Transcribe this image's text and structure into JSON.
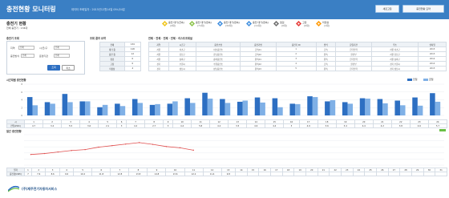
{
  "header": {
    "title": "충전현황 모니터링",
    "datetime": "데이터 조회일자 : 2015년12월14일 09시54분",
    "btn_refresh": "새로고침",
    "btn_settings": "충전현황 요약"
  },
  "info": {
    "title": "충전기 현황",
    "subtitle": "전체 충전기 : 134대"
  },
  "status_legend": [
    {
      "label": "충전 대기(급속)",
      "count": "(4대)",
      "color": "#f0c419"
    },
    {
      "label": "충전 대기(완속)",
      "count": "(71대)",
      "color": "#8bc34a"
    },
    {
      "label": "충전 대기(완속)",
      "count": "(32대)",
      "color": "#3f8ede"
    },
    {
      "label": "충전 대기(완속)",
      "count": "(11대)",
      "color": "#3f8ede"
    },
    {
      "label": "점검",
      "count": "(0대)",
      "color": "#6d6d6d"
    },
    {
      "label": "고장",
      "count": "(0대)",
      "color": "#e53935"
    },
    {
      "label": "미정상",
      "count": "(1대)",
      "color": "#ff9800"
    }
  ],
  "search": {
    "section_title": "충전기 조회",
    "fields": [
      {
        "label": "지역",
        "value": "전체"
      },
      {
        "label": "시/군/구",
        "value": "전체"
      },
      {
        "label": "충전방식",
        "value": "전체"
      },
      {
        "label": "운영기관",
        "value": "전체"
      }
    ],
    "search_btn": "조회",
    "reset_btn": "취소"
  },
  "summary": {
    "section_title": "조회 결과 요약",
    "rows": [
      {
        "k": "전체",
        "v": "134"
      },
      {
        "k": "대기 중",
        "v": "118"
      },
      {
        "k": "충전 중",
        "v": "12"
      },
      {
        "k": "점검",
        "v": "0"
      },
      {
        "k": "고장",
        "v": "0"
      },
      {
        "k": "미정상",
        "v": "4"
      }
    ]
  },
  "list": {
    "section_title": "전체 · 전체 · 전체 · 전체 · 리스트조회설",
    "headers": [
      "지역",
      "시군구",
      "충전소명",
      "충전기명",
      "충전기 ID",
      "방식",
      "운영기관",
      "주소",
      "설치일"
    ],
    "rows": [
      [
        "서울",
        "서초구",
        "서초충전소",
        "급속01",
        "1",
        "급속",
        "한국전력",
        "서울 서초구",
        "2015"
      ],
      [
        "서울",
        "강남구",
        "강남충전소",
        "급속02",
        "2",
        "완속",
        "환경부",
        "서울 강남구",
        "2015"
      ],
      [
        "서울",
        "송파구",
        "송파충전소",
        "완속01",
        "3",
        "완속",
        "한국전력",
        "서울 송파구",
        "2014"
      ],
      [
        "경기",
        "수원시",
        "수원충전소",
        "완속02",
        "4",
        "급속",
        "환경부",
        "경기 수원시",
        "2014"
      ],
      [
        "경기",
        "성남시",
        "성남충전소",
        "완속03",
        "5",
        "완속",
        "한국전력",
        "경기 성남시",
        "2015"
      ]
    ]
  },
  "hourly": {
    "section_title": "시간대별 충전현황",
    "legend": [
      "전일",
      "금일"
    ],
    "row_hours_label": "시",
    "row_prev_label": "전일(kWh)",
    "row_today_label": "금일(kWh)"
  },
  "daily": {
    "section_title": "일간 충전현황",
    "row_day_label": "일자",
    "row_value_label": "충전량(kWh)"
  },
  "footer": {
    "company": "(주)제주전기자동차서비스"
  },
  "chart_data": [
    {
      "type": "bar",
      "title": "",
      "categories": [
        "1",
        "2",
        "3",
        "4",
        "5",
        "6",
        "7",
        "8",
        "9",
        "10",
        "11",
        "12",
        "13",
        "14",
        "15",
        "16",
        "17",
        "18",
        "19",
        "20",
        "21",
        "22",
        "23",
        "24"
      ],
      "series": [
        {
          "name": "전일",
          "values": [
            4.7,
            3.4,
            5.5,
            3.6,
            2.1,
            3.0,
            4.2,
            2.7,
            3.0,
            4.4,
            5.8,
            4.2,
            3.5,
            4.6,
            4.4,
            3.0,
            4.9,
            3.6,
            3.4,
            4.4,
            4.2,
            3.8,
            4.6,
            5.7
          ]
        },
        {
          "name": "금일",
          "values": [
            2.6,
            3.0,
            3.4,
            3.6,
            2.7,
            2.4,
            3.2,
            2.9,
            3.6,
            3.2,
            4.3,
            3.2,
            3.8,
            3.3,
            2.1,
            2.9,
            4.7,
            3.9,
            3.0,
            4.3,
            3.1,
            2.6,
            2.5,
            3.5
          ]
        }
      ],
      "ylim": [
        0,
        8
      ],
      "colors": [
        "#2d6fc2",
        "#7fb0e6"
      ]
    },
    {
      "type": "line",
      "title": "",
      "x": [
        "1",
        "2",
        "3",
        "4",
        "5",
        "6",
        "7",
        "8",
        "9",
        "10",
        "11",
        "12",
        "13",
        "14",
        "15",
        "16",
        "17",
        "18",
        "19",
        "20",
        "21",
        "22",
        "23",
        "24",
        "25",
        "26",
        "27",
        "28",
        "29",
        "30",
        "31"
      ],
      "y": [
        7.0,
        7.6,
        8.6,
        9.6,
        10.2,
        11.8,
        12.8,
        13.8,
        14.8,
        13.6,
        12.2,
        11.4,
        9.8,
        null,
        null,
        null,
        null,
        null,
        null,
        null,
        null,
        null,
        null,
        null,
        null,
        null,
        null,
        null,
        null,
        null,
        null
      ],
      "ylim": [
        0,
        20
      ],
      "color": "#e05050"
    }
  ]
}
